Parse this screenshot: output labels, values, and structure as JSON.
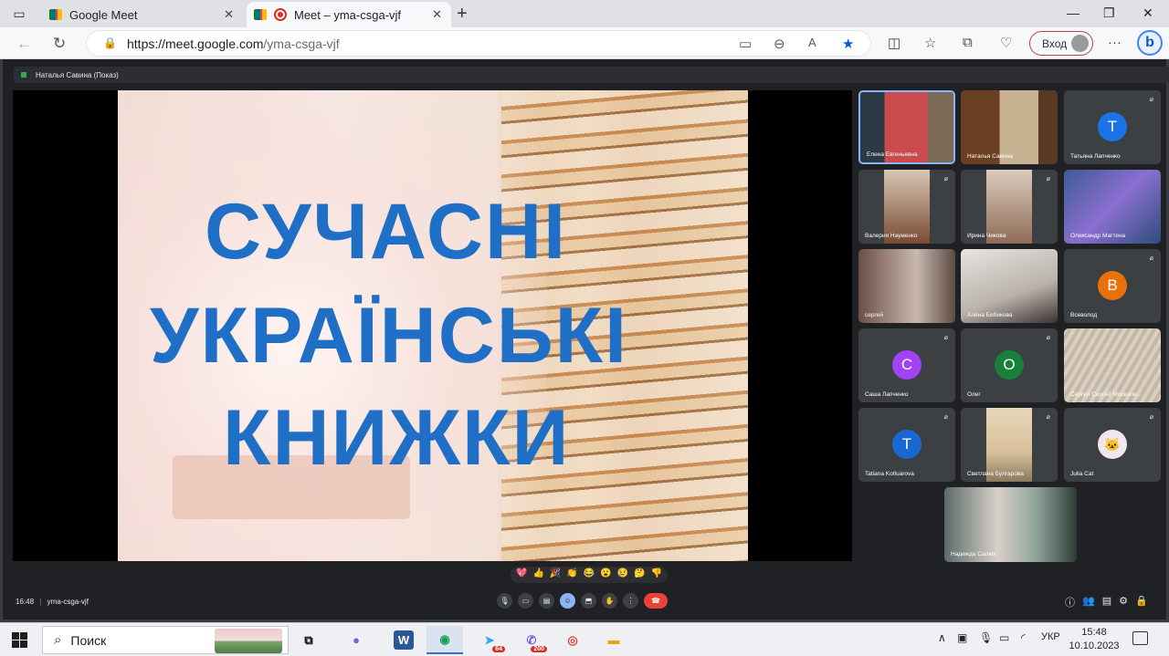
{
  "browser": {
    "tabs": [
      {
        "title": "Google Meet"
      },
      {
        "title": "Meet – yma-csga-vjf"
      }
    ],
    "url_host": "https://meet.google.com",
    "url_path": "/yma-csga-vjf",
    "login_label": "Вход",
    "bing_label": "b"
  },
  "meet": {
    "presenter_label": "Наталья Савина (Показ)",
    "slide_lines": [
      "СУЧАСНІ",
      "УКРАЇНСЬКІ",
      "КНИЖКИ"
    ],
    "time": "16:48",
    "meeting_code": "yma-csga-vjf",
    "reactions": [
      "💖",
      "👍",
      "🎉",
      "👏",
      "😂",
      "😮",
      "😢",
      "🤔",
      "👎"
    ],
    "participants": [
      {
        "name": "Елена Евгеньевна",
        "type": "video"
      },
      {
        "name": "Наталья Савина",
        "type": "video"
      },
      {
        "name": "Татьяна Лапченко",
        "type": "avatar",
        "initial": "T",
        "color": "#1a73e8"
      },
      {
        "name": "Валерия Науменко",
        "type": "video"
      },
      {
        "name": "Ирина Чикова",
        "type": "video"
      },
      {
        "name": "Олександр Магтена",
        "type": "video"
      },
      {
        "name": "сергей",
        "type": "video"
      },
      {
        "name": "Алёна Бибикова",
        "type": "video"
      },
      {
        "name": "Всеволод",
        "type": "avatar",
        "initial": "B",
        "color": "#e8710a"
      },
      {
        "name": "Саша Лапченко",
        "type": "avatar",
        "initial": "C",
        "color": "#a142f4"
      },
      {
        "name": "Олег",
        "type": "avatar",
        "initial": "O",
        "color": "#188038"
      },
      {
        "name": "Сергей Сергей Москале...",
        "type": "video"
      },
      {
        "name": "Tatiana Kotluarova",
        "type": "avatar",
        "initial": "T",
        "color": "#1967d2"
      },
      {
        "name": "Светлана Булгарова",
        "type": "video"
      },
      {
        "name": "Julia Cat",
        "type": "avatar-image"
      },
      {
        "name": "Надежда Салюк",
        "type": "video"
      }
    ]
  },
  "taskbar": {
    "search_label": "Поиск",
    "word_label": "W",
    "telegram_badge": "64",
    "viber_badge": "200",
    "language": "УКР",
    "clock_time": "15:48",
    "clock_date": "10.10.2023"
  }
}
